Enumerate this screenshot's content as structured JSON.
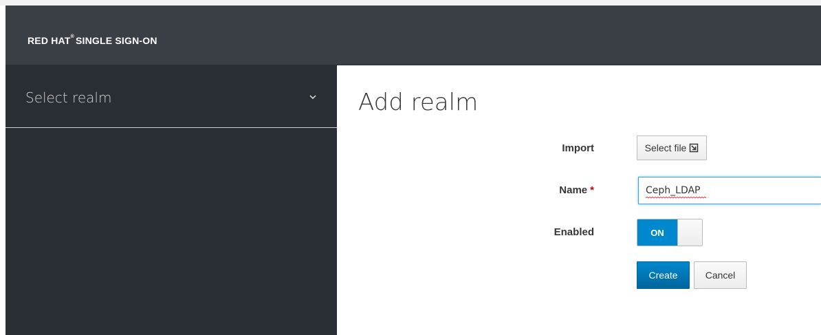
{
  "header": {
    "brand_primary": "RED HAT",
    "brand_mark": "®",
    "brand_secondary": "SINGLE SIGN-ON"
  },
  "sidebar": {
    "realm_select_label": "Select realm",
    "chevron_icon": "chevron-down-icon"
  },
  "main": {
    "title": "Add realm",
    "form": {
      "import_label": "Import",
      "select_file_label": "Select file",
      "select_file_icon": "file-import-icon",
      "name_label": "Name",
      "name_required_marker": "*",
      "name_value": "Ceph_LDAP",
      "enabled_label": "Enabled",
      "enabled_toggle_text": "ON",
      "create_label": "Create",
      "cancel_label": "Cancel"
    }
  },
  "colors": {
    "navbar_bg": "#393f44",
    "sidebar_bg": "#292e34",
    "primary": "#0088ce",
    "required": "#cc0000"
  }
}
